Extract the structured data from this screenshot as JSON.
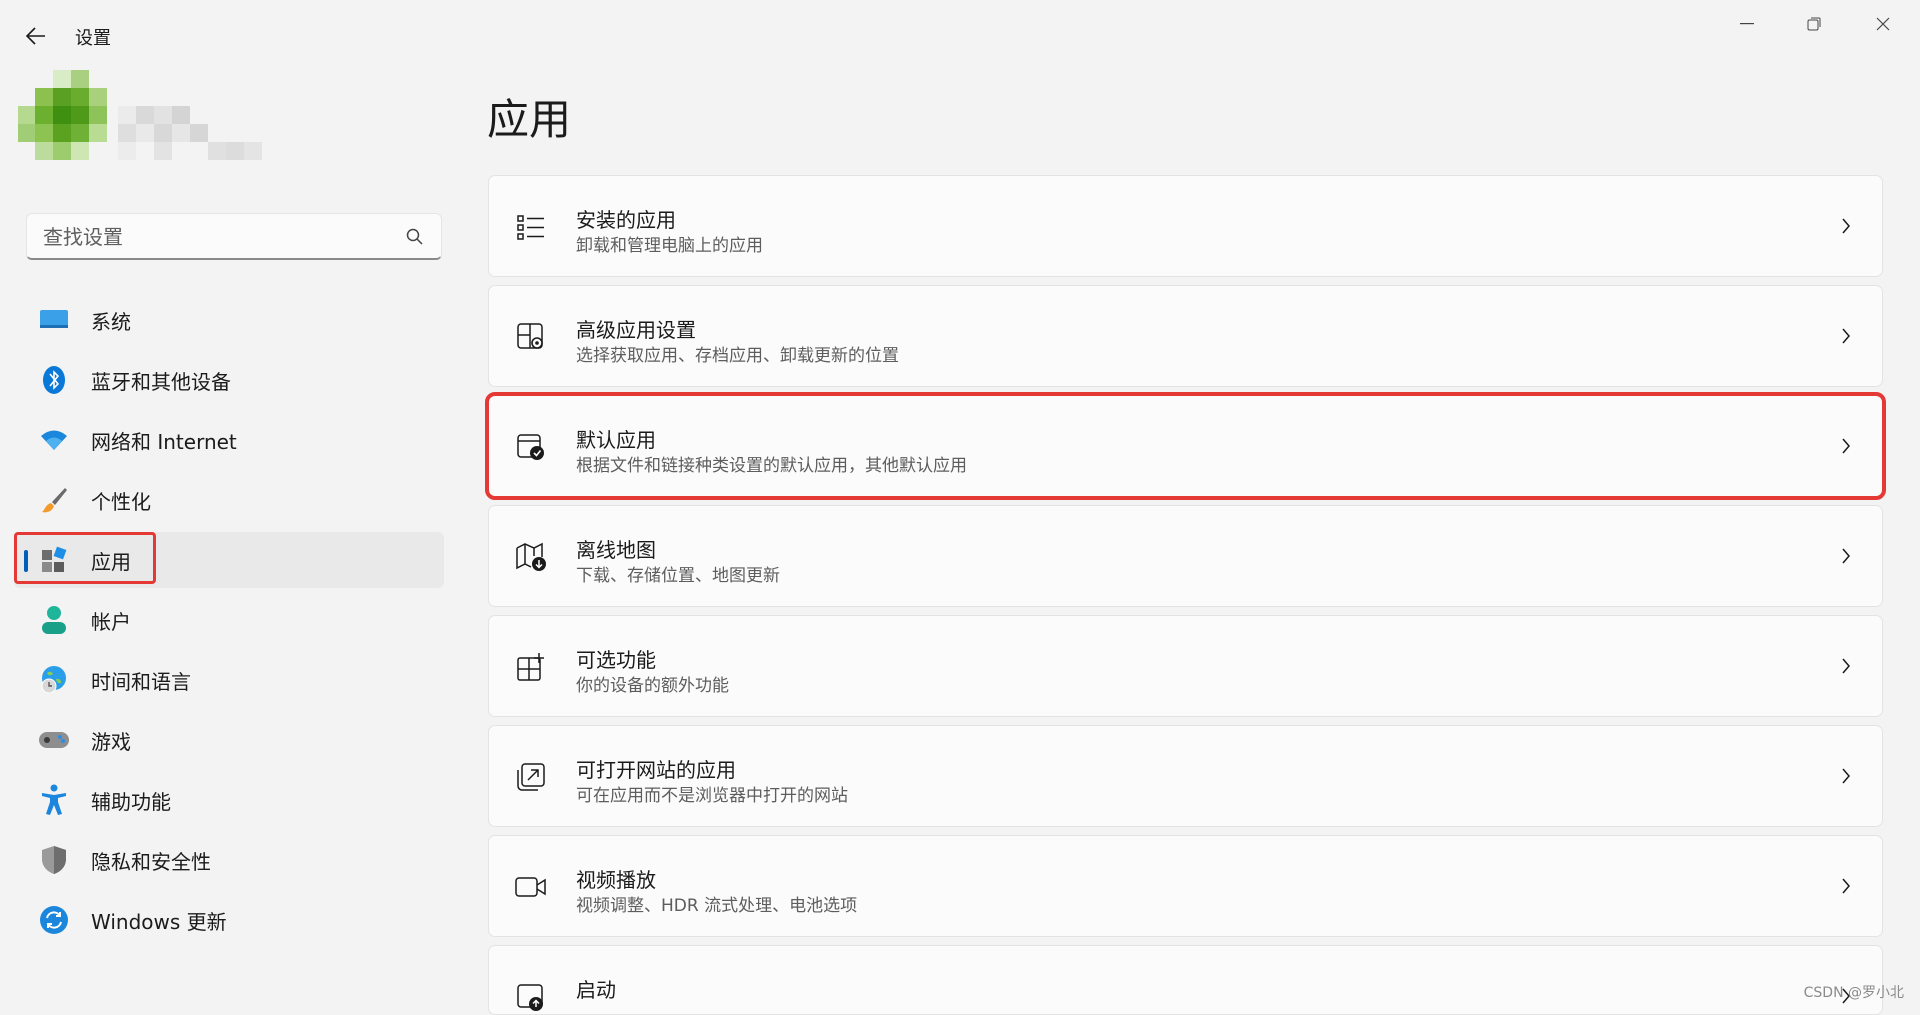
{
  "window": {
    "title": "设置",
    "controls": [
      "minimize-icon",
      "maximize-icon",
      "close-icon"
    ]
  },
  "search": {
    "placeholder": "查找设置",
    "value": ""
  },
  "sidebar": {
    "items": [
      {
        "label": "系统",
        "icon": "system-icon",
        "active": false
      },
      {
        "label": "蓝牙和其他设备",
        "icon": "bluetooth-icon",
        "active": false
      },
      {
        "label": "网络和 Internet",
        "icon": "wifi-icon",
        "active": false
      },
      {
        "label": "个性化",
        "icon": "brush-icon",
        "active": false
      },
      {
        "label": "应用",
        "icon": "apps-icon",
        "active": true
      },
      {
        "label": "帐户",
        "icon": "account-icon",
        "active": false
      },
      {
        "label": "时间和语言",
        "icon": "time-language-icon",
        "active": false
      },
      {
        "label": "游戏",
        "icon": "gaming-icon",
        "active": false
      },
      {
        "label": "辅助功能",
        "icon": "accessibility-icon",
        "active": false
      },
      {
        "label": "隐私和安全性",
        "icon": "shield-icon",
        "active": false
      },
      {
        "label": "Windows 更新",
        "icon": "update-icon",
        "active": false
      }
    ]
  },
  "main": {
    "title": "应用",
    "cards": [
      {
        "title": "安装的应用",
        "subtitle": "卸载和管理电脑上的应用",
        "icon": "installed-apps-icon"
      },
      {
        "title": "高级应用设置",
        "subtitle": "选择获取应用、存档应用、卸载更新的位置",
        "icon": "advanced-settings-icon"
      },
      {
        "title": "默认应用",
        "subtitle": "根据文件和链接种类设置的默认应用，其他默认应用",
        "icon": "default-apps-icon",
        "highlighted": true
      },
      {
        "title": "离线地图",
        "subtitle": "下载、存储位置、地图更新",
        "icon": "offline-maps-icon"
      },
      {
        "title": "可选功能",
        "subtitle": "你的设备的额外功能",
        "icon": "optional-features-icon"
      },
      {
        "title": "可打开网站的应用",
        "subtitle": "可在应用而不是浏览器中打开的网站",
        "icon": "apps-for-websites-icon"
      },
      {
        "title": "视频播放",
        "subtitle": "视频调整、HDR 流式处理、电池选项",
        "icon": "video-playback-icon"
      },
      {
        "title": "启动",
        "subtitle": "",
        "icon": "startup-icon"
      }
    ]
  },
  "watermark": "CSDN @罗小北",
  "colors": {
    "accent": "#005fb8",
    "highlight": "#e53935",
    "background": "#f3f3f3"
  }
}
